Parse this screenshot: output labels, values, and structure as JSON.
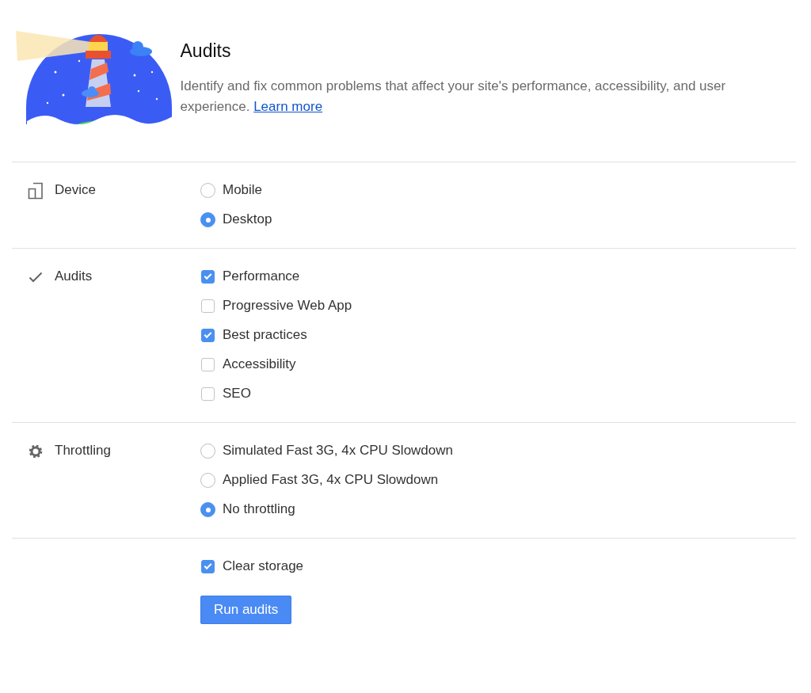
{
  "header": {
    "title": "Audits",
    "description": "Identify and fix common problems that affect your site's performance, accessibility, and user experience.",
    "link": "Learn more"
  },
  "sections": [
    {
      "label": "Device",
      "kind": "radio",
      "options": [
        {
          "label": "Mobile",
          "selected": false
        },
        {
          "label": "Desktop",
          "selected": true
        }
      ]
    },
    {
      "label": "Audits",
      "kind": "checkbox",
      "options": [
        {
          "label": "Performance",
          "checked": true
        },
        {
          "label": "Progressive Web App",
          "checked": false
        },
        {
          "label": "Best practices",
          "checked": true
        },
        {
          "label": "Accessibility",
          "checked": false
        },
        {
          "label": "SEO",
          "checked": false
        }
      ]
    },
    {
      "label": "Throttling",
      "kind": "radio",
      "options": [
        {
          "label": "Simulated Fast 3G, 4x CPU Slowdown",
          "selected": false
        },
        {
          "label": "Applied Fast 3G, 4x CPU Slowdown",
          "selected": false
        },
        {
          "label": "No throttling",
          "selected": true
        }
      ]
    }
  ],
  "extra_options": [
    {
      "label": "Clear storage",
      "checked": true
    }
  ],
  "run_button": "Run audits"
}
